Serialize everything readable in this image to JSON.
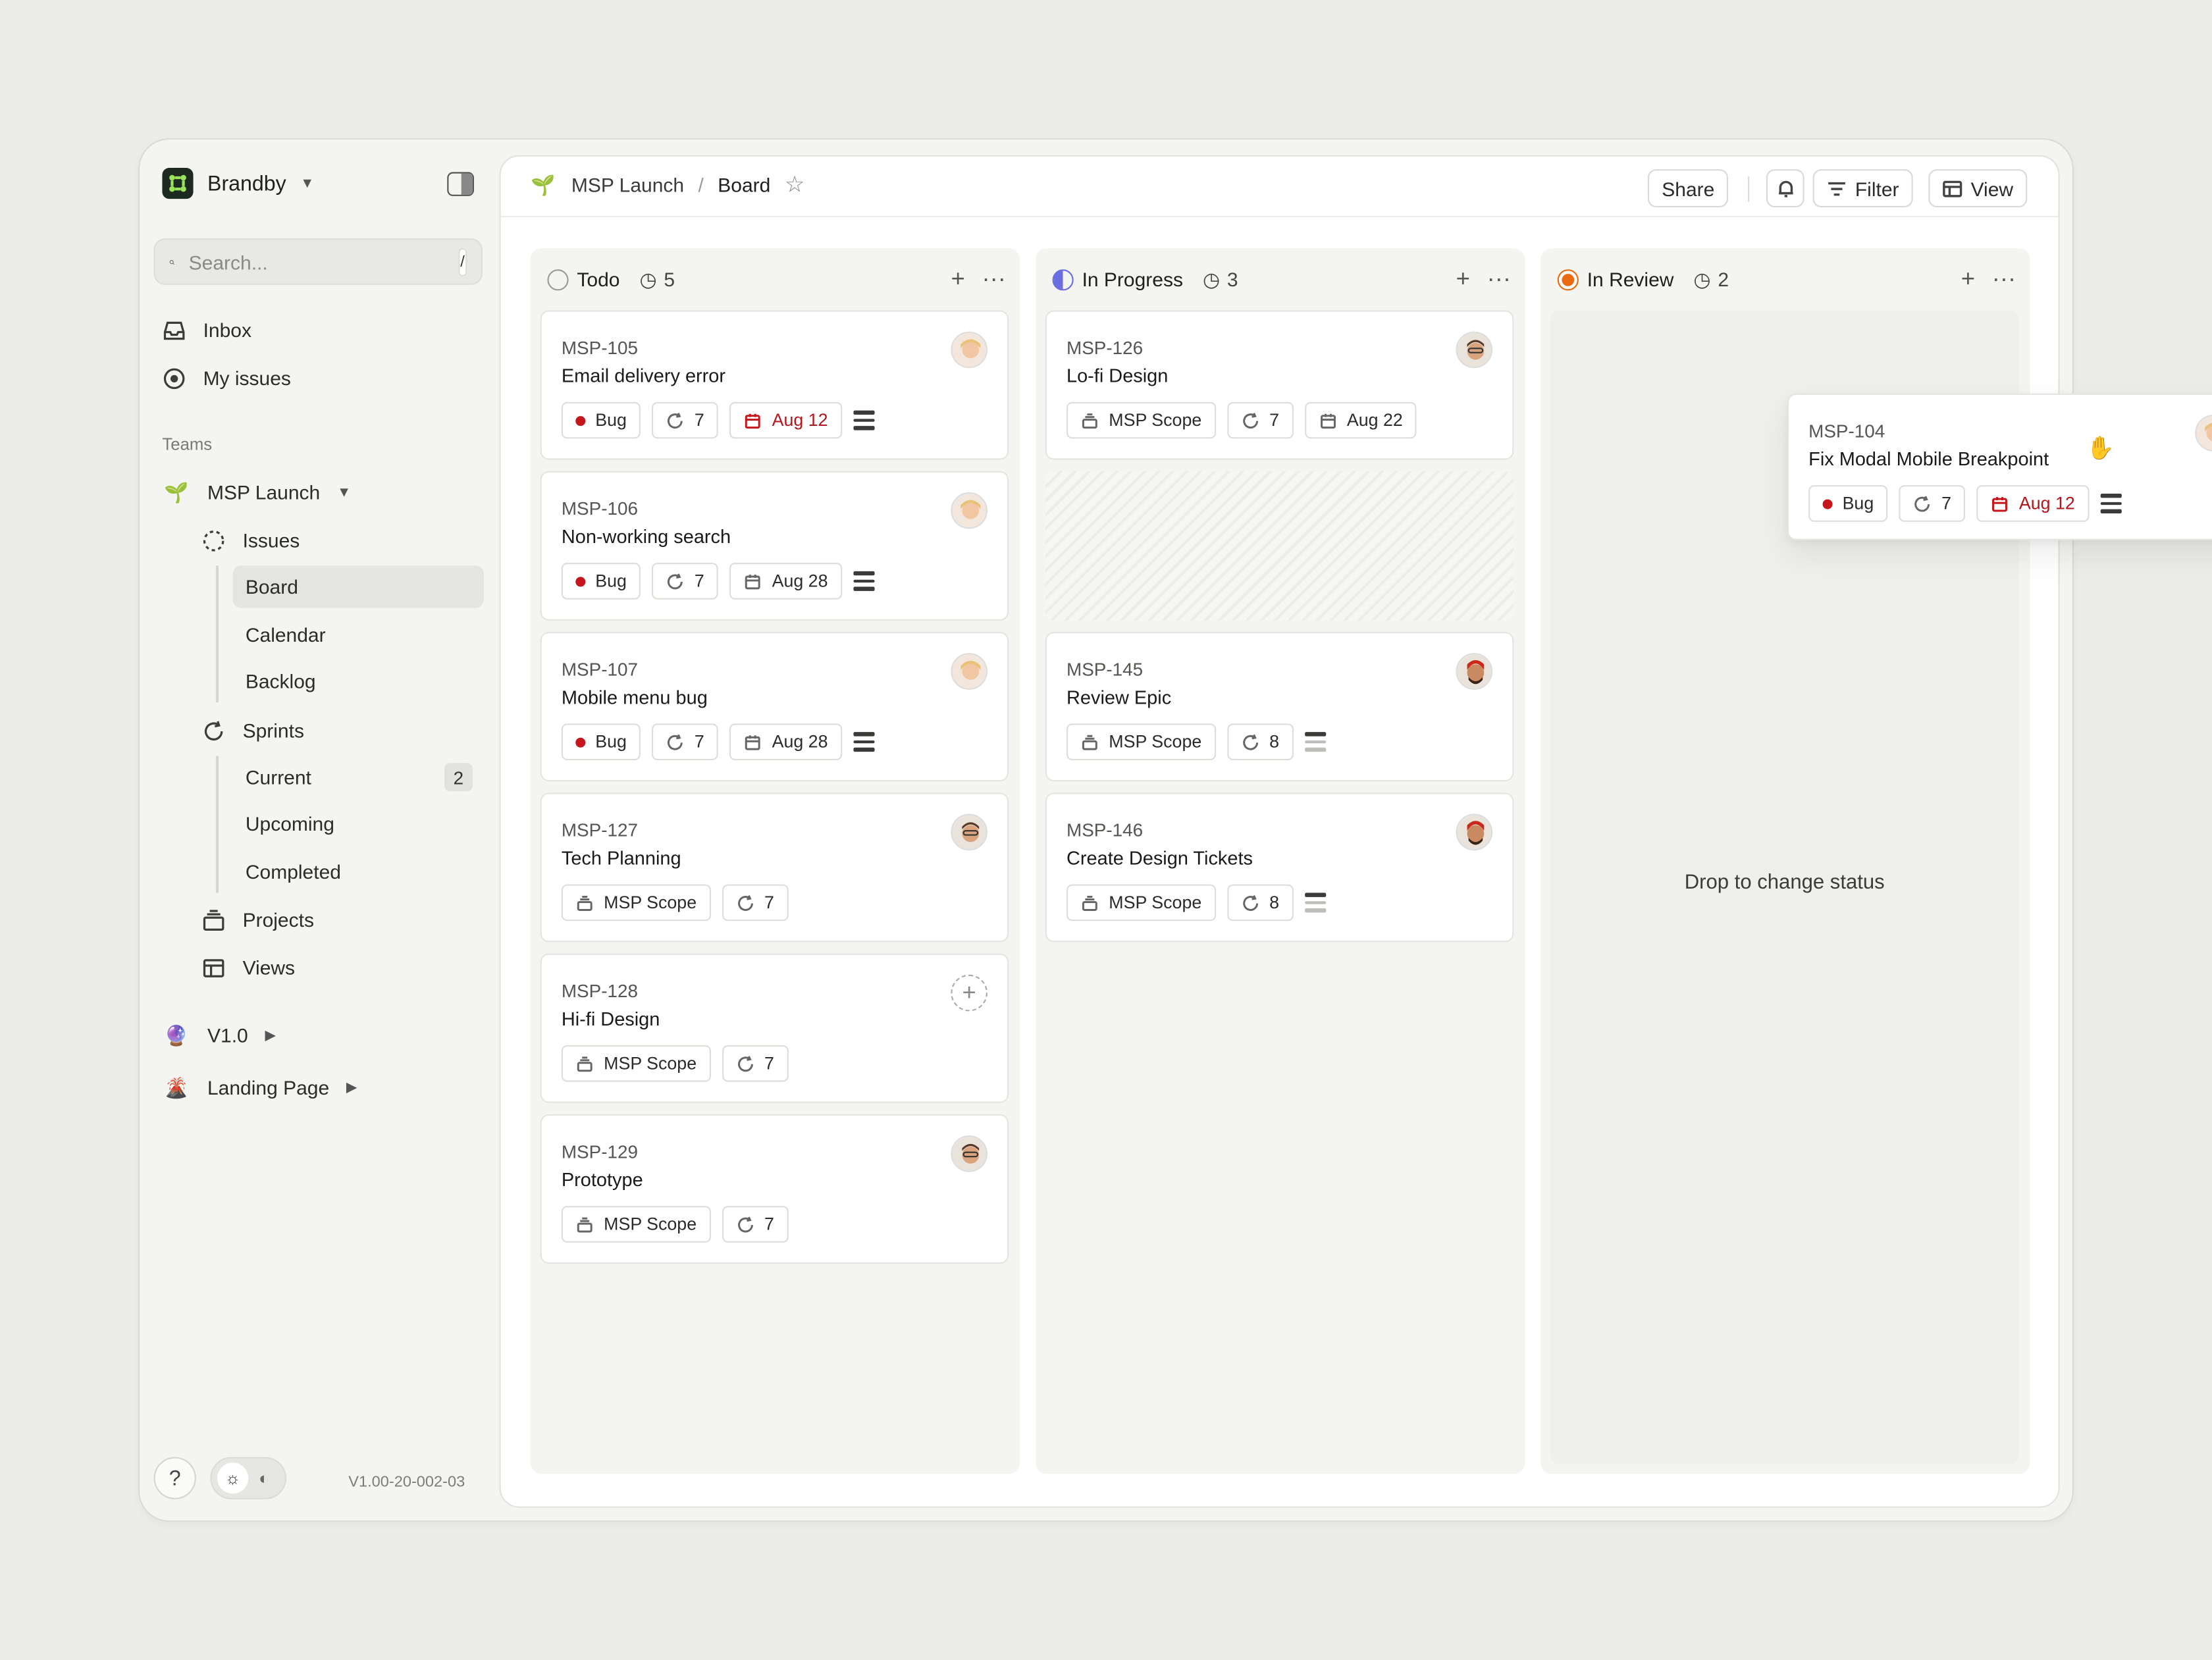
{
  "workspace": {
    "name": "Brandby"
  },
  "search": {
    "placeholder": "Search...",
    "shortcut": "/"
  },
  "nav": {
    "inbox": "Inbox",
    "my_issues": "My issues"
  },
  "teams_label": "Teams",
  "team": {
    "name": "MSP Launch",
    "issues": "Issues",
    "board": "Board",
    "calendar": "Calendar",
    "backlog": "Backlog",
    "sprints": "Sprints",
    "current": "Current",
    "current_count": "2",
    "upcoming": "Upcoming",
    "completed": "Completed",
    "projects": "Projects",
    "views": "Views"
  },
  "other_teams": [
    {
      "name": "V1.0"
    },
    {
      "name": "Landing Page"
    }
  ],
  "footer": {
    "help": "?",
    "version": "V1.00-20-002-03"
  },
  "breadcrumb": {
    "team": "MSP Launch",
    "sep": "/",
    "page": "Board"
  },
  "toolbar": {
    "share": "Share",
    "filter": "Filter",
    "view": "View"
  },
  "columns": [
    {
      "name": "Todo",
      "count": "5",
      "status_color": "#9a9a96",
      "cards": [
        {
          "key": "MSP-105",
          "title": "Email delivery error",
          "label": "Bug",
          "cycle": "7",
          "due": "Aug 12",
          "due_overdue": true
        },
        {
          "key": "MSP-106",
          "title": "Non-working search",
          "label": "Bug",
          "cycle": "7",
          "due": "Aug 28"
        },
        {
          "key": "MSP-107",
          "title": "Mobile menu bug",
          "label": "Bug",
          "cycle": "7",
          "due": "Aug 28"
        },
        {
          "key": "MSP-127",
          "title": "Tech Planning",
          "label": "MSP Scope",
          "cycle": "7"
        },
        {
          "key": "MSP-128",
          "title": "Hi-fi Design",
          "label": "MSP Scope",
          "cycle": "7"
        },
        {
          "key": "MSP-129",
          "title": "Prototype",
          "label": "MSP Scope",
          "cycle": "7"
        }
      ]
    },
    {
      "name": "In Progress",
      "count": "3",
      "status_color": "#6b6ee0",
      "cards": [
        {
          "key": "MSP-126",
          "title": "Lo-fi Design",
          "label": "MSP Scope",
          "cycle": "7",
          "due": "Aug 22"
        },
        {
          "key": "MSP-145",
          "title": "Review Epic",
          "label": "MSP Scope",
          "cycle": "8"
        },
        {
          "key": "MSP-146",
          "title": "Create Design Tickets",
          "label": "MSP Scope",
          "cycle": "8"
        }
      ]
    },
    {
      "name": "In Review",
      "count": "2",
      "status_color": "#ea6a12",
      "drop_text": "Drop to change status"
    }
  ],
  "dragging_card": {
    "key": "MSP-104",
    "title": "Fix Modal Mobile Breakpoint",
    "label": "Bug",
    "cycle": "7",
    "due": "Aug 12"
  },
  "colors": {
    "accent_green": "#1d2a1f",
    "bug_red": "#c4161c"
  }
}
